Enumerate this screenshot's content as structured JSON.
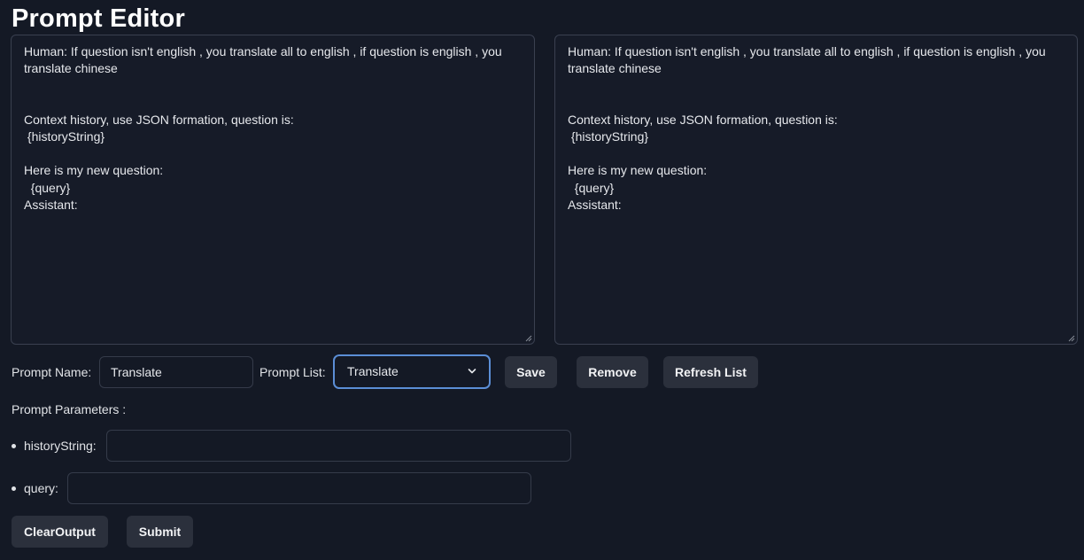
{
  "page": {
    "title": "Prompt Editor"
  },
  "editors": {
    "left_text": "Human: If question isn't english , you translate all to english , if question is english , you translate chinese\n\n\nContext history, use JSON formation, question is:\n {historyString}\n\nHere is my new question:\n  {query}\nAssistant:",
    "right_text": "Human: If question isn't english , you translate all to english , if question is english , you translate chinese\n\n\nContext history, use JSON formation, question is:\n {historyString}\n\nHere is my new question:\n  {query}\nAssistant:"
  },
  "controls": {
    "prompt_name_label": "Prompt Name:",
    "prompt_name_value": "Translate",
    "prompt_list_label": "Prompt List:",
    "prompt_list_selected": "Translate",
    "save_label": "Save",
    "remove_label": "Remove",
    "refresh_label": "Refresh List"
  },
  "parameters": {
    "label": "Prompt Parameters :",
    "items": [
      {
        "name": "historyString:",
        "value": ""
      },
      {
        "name": "query:",
        "value": ""
      }
    ]
  },
  "actions": {
    "clear_label": "ClearOutput",
    "submit_label": "Submit"
  },
  "icons": {
    "select_chevron": "chevron-down-icon",
    "resize_grip": "resize-grip-icon"
  },
  "colors": {
    "background": "#141925",
    "border": "#3a4050",
    "button": "#2b303c",
    "focus": "#5b8ed6"
  }
}
